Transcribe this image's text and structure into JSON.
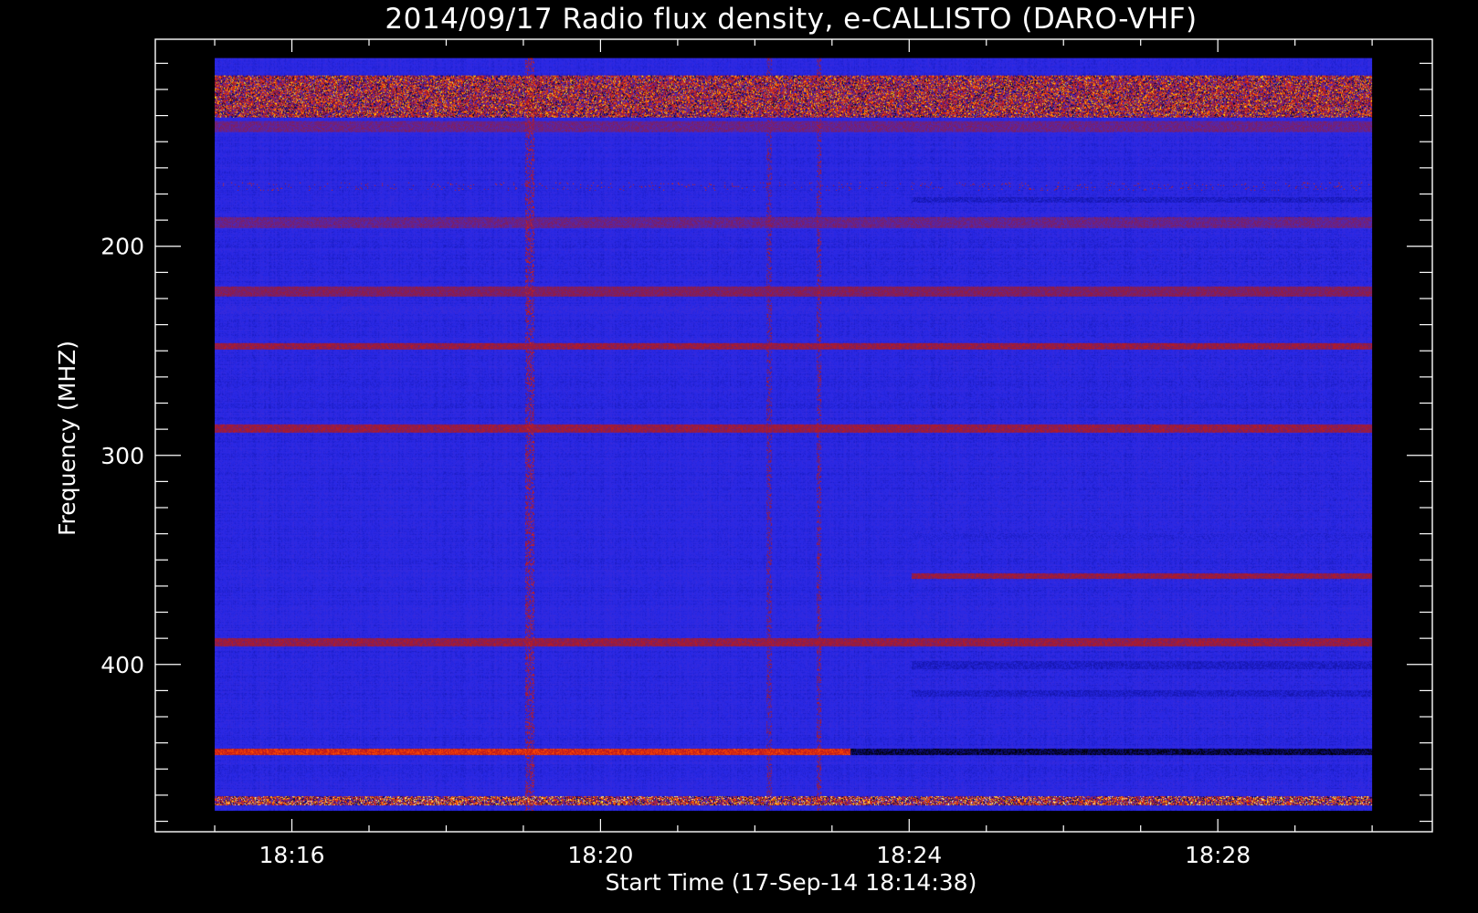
{
  "chart_data": {
    "type": "heatmap",
    "title": "2014/09/17  Radio flux density, e-CALLISTO (DARO-VHF)",
    "xlabel": "Start Time (17-Sep-14 18:14:38)",
    "ylabel": "Frequency (MHZ)",
    "x_unit": "minutes after 18:14:38",
    "x_data_range": [
      0.37,
      15.37
    ],
    "xlim": [
      -0.4,
      16.15
    ],
    "ylim": [
      101,
      480
    ],
    "y_inverted": true,
    "y_data_range": [
      110,
      470
    ],
    "x_ticks": [
      {
        "value": 1.37,
        "label": "18:16"
      },
      {
        "value": 5.37,
        "label": "18:20"
      },
      {
        "value": 9.37,
        "label": "18:24"
      },
      {
        "value": 13.37,
        "label": "18:28"
      }
    ],
    "x_minor_step": 1,
    "y_ticks": [
      {
        "value": 200,
        "label": "200"
      },
      {
        "value": 300,
        "label": "300"
      },
      {
        "value": 400,
        "label": "400"
      }
    ],
    "y_minor_step": 12.5,
    "colormap": [
      "#000000",
      "#1010a0",
      "#2828e6",
      "#3c2ad8",
      "#8a1c4c",
      "#c41a1a",
      "#ff4a00",
      "#ffd200",
      "#ffffff"
    ],
    "background_color": "#2a22d4",
    "frame_color": "#ffffff",
    "horizontal_bands": [
      {
        "freq_min": 118,
        "freq_max": 138,
        "level": 0.75,
        "kind": "bursty"
      },
      {
        "freq_min": 140,
        "freq_max": 145,
        "level": 0.45,
        "kind": "dark"
      },
      {
        "freq_min": 169,
        "freq_max": 173,
        "level": 0.62,
        "kind": "spotty"
      },
      {
        "freq_min": 176,
        "freq_max": 179,
        "level": 0.2,
        "kind": "dark",
        "x_start": 9.4
      },
      {
        "freq_min": 186,
        "freq_max": 191,
        "level": 0.45,
        "kind": "dark"
      },
      {
        "freq_min": 219,
        "freq_max": 224,
        "level": 0.5,
        "kind": "dark"
      },
      {
        "freq_min": 228,
        "freq_max": 232,
        "level": 0.3,
        "kind": "dark"
      },
      {
        "freq_min": 246,
        "freq_max": 249,
        "level": 0.55,
        "kind": "reddish"
      },
      {
        "freq_min": 285,
        "freq_max": 289,
        "level": 0.55,
        "kind": "reddish"
      },
      {
        "freq_min": 337,
        "freq_max": 340,
        "level": 0.25,
        "kind": "dark",
        "x_start": 9.4
      },
      {
        "freq_min": 356,
        "freq_max": 359,
        "level": 0.55,
        "kind": "reddish",
        "x_start": 9.4
      },
      {
        "freq_min": 387,
        "freq_max": 391,
        "level": 0.55,
        "kind": "reddish"
      },
      {
        "freq_min": 398,
        "freq_max": 402,
        "level": 0.2,
        "kind": "dark",
        "x_start": 9.4
      },
      {
        "freq_min": 412,
        "freq_max": 415,
        "level": 0.2,
        "kind": "dark",
        "x_start": 9.4
      },
      {
        "freq_min": 440,
        "freq_max": 443,
        "level": 0.7,
        "kind": "reddish",
        "x_end": 8.6
      },
      {
        "freq_min": 440,
        "freq_max": 443,
        "level": 0.05,
        "kind": "dark",
        "x_start": 8.6
      },
      {
        "freq_min": 463,
        "freq_max": 467,
        "level": 0.82,
        "kind": "bursty"
      }
    ],
    "vertical_features": [
      {
        "time": 4.45,
        "width": 0.06,
        "level": 0.6
      },
      {
        "time": 8.2,
        "width": 0.03,
        "level": 0.55
      },
      {
        "time": 7.55,
        "width": 0.03,
        "level": 0.5
      }
    ]
  }
}
